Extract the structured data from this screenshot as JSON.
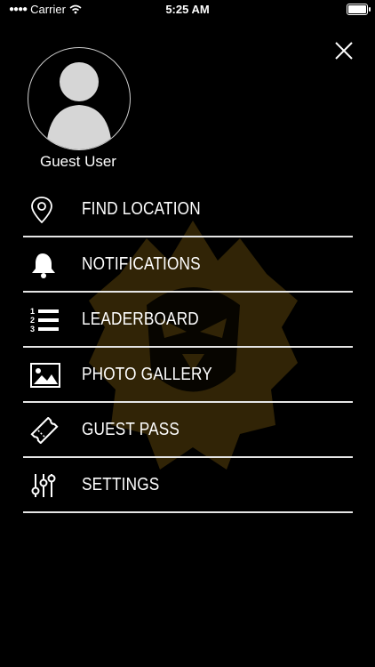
{
  "status_bar": {
    "carrier": "Carrier",
    "time": "5:25 AM"
  },
  "user": {
    "name": "Guest User"
  },
  "menu": {
    "items": [
      {
        "label": "FIND LOCATION",
        "icon": "location-pin-icon"
      },
      {
        "label": "NOTIFICATIONS",
        "icon": "bell-icon"
      },
      {
        "label": "LEADERBOARD",
        "icon": "ranked-list-icon"
      },
      {
        "label": "PHOTO GALLERY",
        "icon": "photo-icon"
      },
      {
        "label": "GUEST PASS",
        "icon": "ticket-icon"
      },
      {
        "label": "SETTINGS",
        "icon": "sliders-icon"
      }
    ]
  },
  "colors": {
    "background": "#000000",
    "text": "#ffffff",
    "divider": "#e6e6e6",
    "watermark": "#7a5c12"
  }
}
